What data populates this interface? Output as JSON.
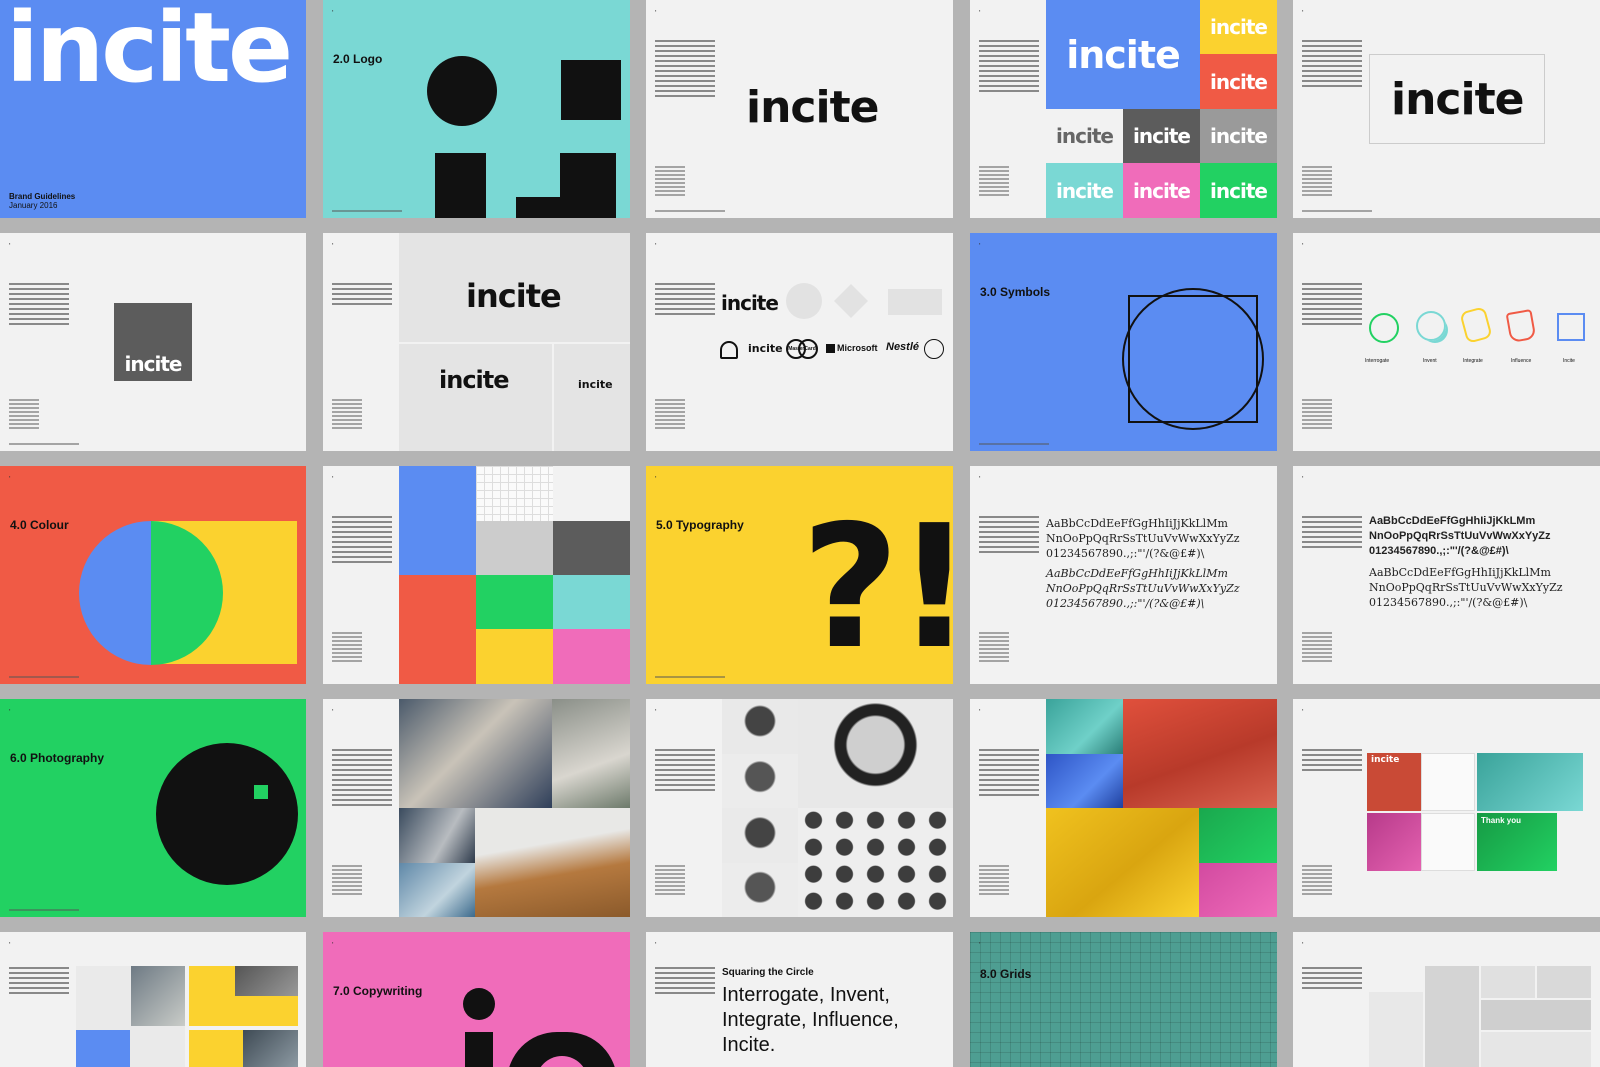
{
  "cover": {
    "wordmark": "incite",
    "title": "Brand Guidelines",
    "date": "January 2016"
  },
  "sections": {
    "logo": "2.0 Logo",
    "symbols": "3.0 Symbols",
    "colour": "4.0 Colour",
    "typography": "5.0 Typography",
    "photography": "6.0 Photography",
    "copywriting": "7.0 Copywriting",
    "grids": "8.0 Grids"
  },
  "logo_word": "incite",
  "partner_logos": [
    "incite",
    "MasterCard",
    "Microsoft",
    "Nestlé"
  ],
  "symbol_labels": [
    "Interrogate",
    "Invent",
    "Integrate",
    "Influence",
    "Incite"
  ],
  "typography_glyph": "?!",
  "type_samples": {
    "serif_a": "AaBbCcDdEeFfGgHhIiJjKkLlMm\nNnOoPpQqRrSsTtUuVvWwXxYyZz\n01234567890.,;:\"'/(?&@£#)\\",
    "serif_b": "AaBbCcDdEeFfGgHhIiJjKkLlMm\nNnOoPpQqRrSsTtUuVvWwXxYyZz\n01234567890.,;:\"'/(?&@£#)\\",
    "bold_a": "AaBbCcDdEeFfGgHhIiJjKkLMm\nNnOoPpQqRrSsTtUuVvWwXxYyZz\n01234567890.,;:\"'/(?&@£#)\\",
    "serif_c": "AaBbCcDdEeFfGgHhIiJjKkLlMm\nNnOoPpQqRrSsTtUuVvWwXxYyZz\n01234567890.,;:\"'/(?&@£#)\\"
  },
  "applications": {
    "tag_1": "Thank you",
    "tag_2": "incite"
  },
  "copy_slide": {
    "small_title": "Squaring the Circle",
    "big_lines": [
      "Interrogate, Invent,",
      "Integrate, Influence,",
      "Incite."
    ]
  },
  "colors": {
    "blue": "#5b8cf2",
    "teal": "#7ad8d4",
    "red": "#f05a45",
    "yellow": "#fbd22f",
    "green": "#22d162",
    "pink": "#f06cba",
    "grey": "#5c5c5c",
    "black": "#111111"
  }
}
